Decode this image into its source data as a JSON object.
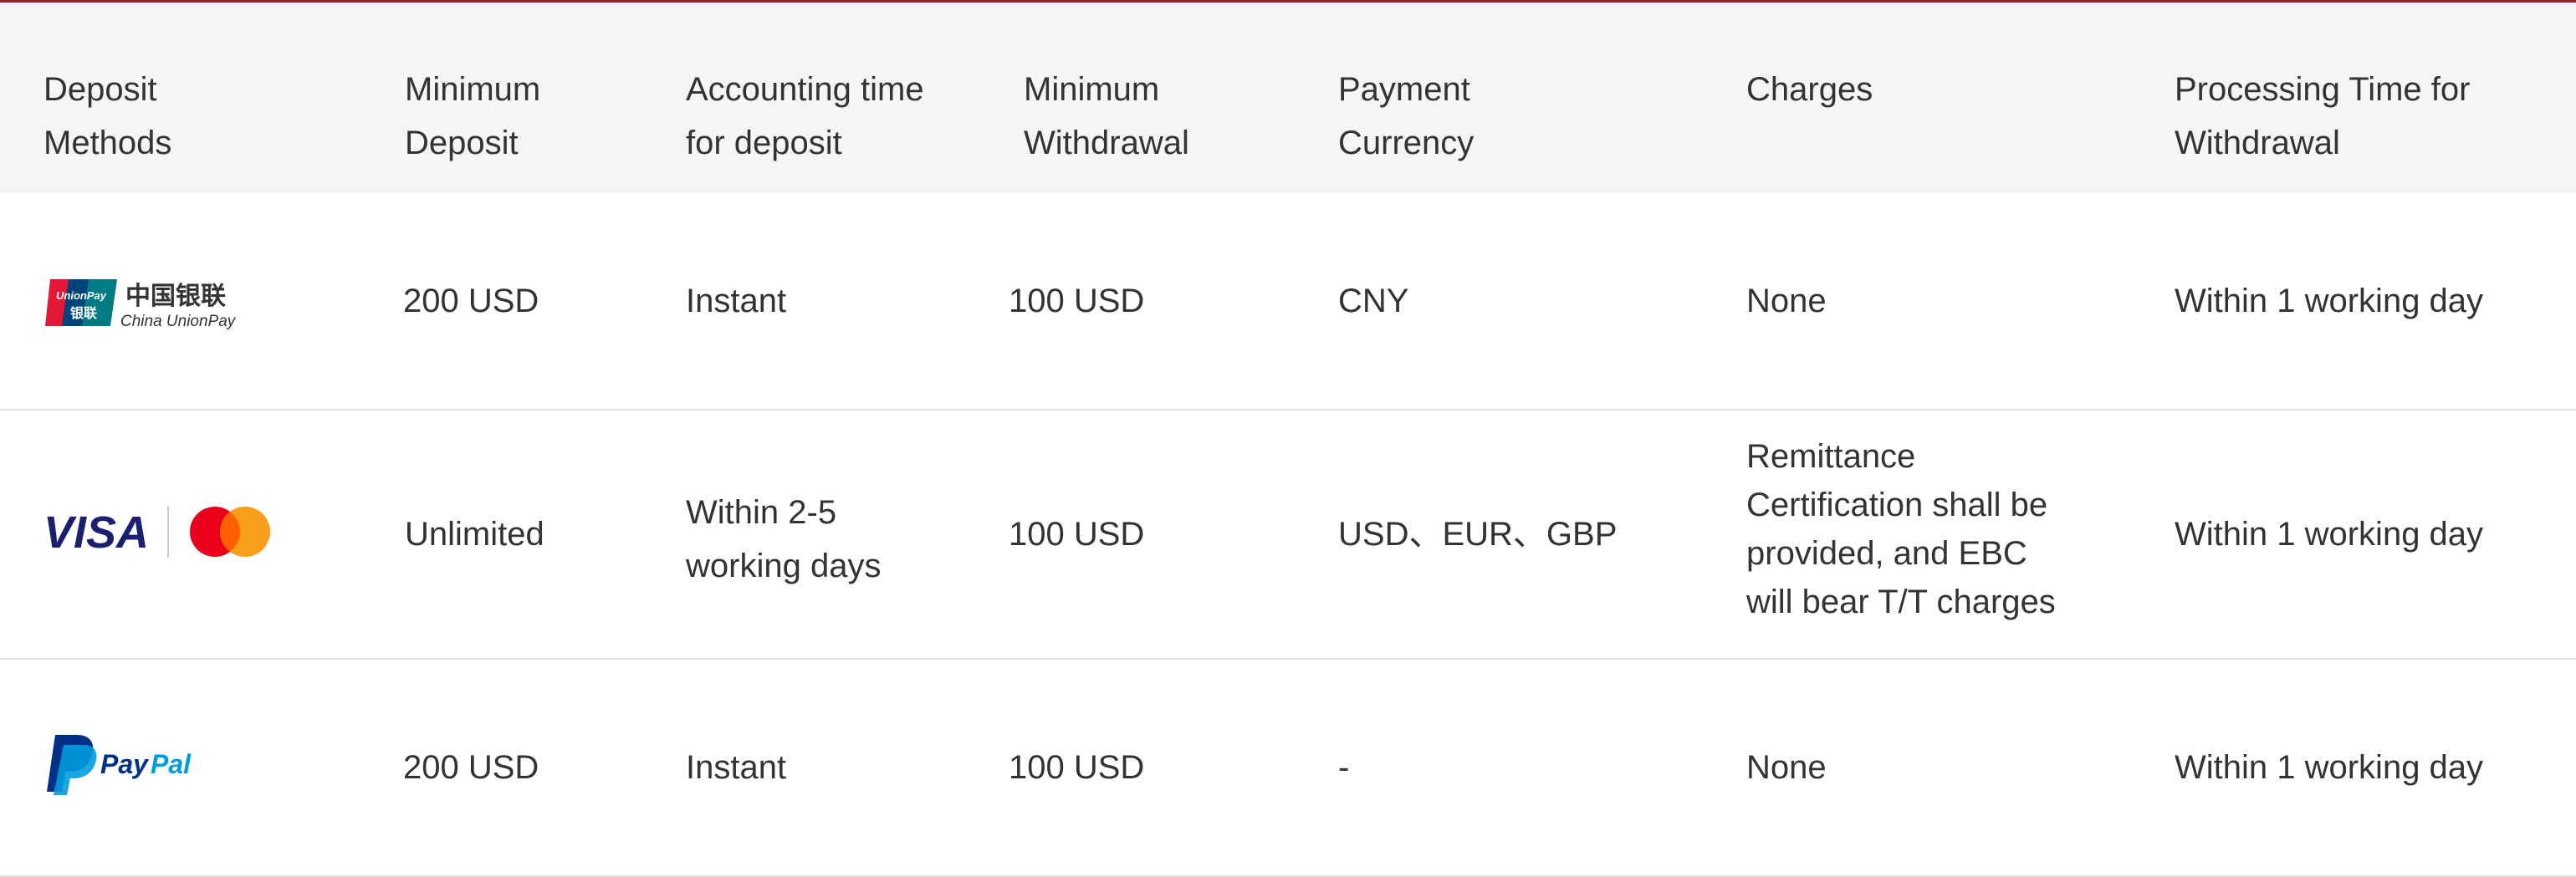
{
  "header": {
    "col1": [
      "Deposit",
      "Methods"
    ],
    "col2": [
      "Minimum",
      "Deposit"
    ],
    "col3": [
      "Accounting time",
      "for deposit"
    ],
    "col4": [
      "Minimum",
      "Withdrawal"
    ],
    "col5": [
      "Payment",
      "Currency"
    ],
    "col6": [
      "Charges",
      ""
    ],
    "col7": [
      "Processing Time for",
      "Withdrawal"
    ]
  },
  "rows": [
    {
      "method_icon": "unionpay-logo",
      "logo_text": {
        "cn": "中国银联",
        "en": "China UnionPay",
        "badge_top": "UnionPay",
        "badge_bottom": "银联"
      },
      "min_deposit": "200 USD",
      "accounting_time": [
        "Instant"
      ],
      "min_withdrawal": "100 USD",
      "currency": "CNY",
      "charges": [
        "None"
      ],
      "processing_time": "Within 1 working day"
    },
    {
      "method_icon": "visa-mastercard-logo",
      "logo_text": {
        "visa": "VISA"
      },
      "min_deposit": "Unlimited",
      "accounting_time": [
        "Within 2-5",
        "working days"
      ],
      "min_withdrawal": "100 USD",
      "currency": "USD、EUR、GBP",
      "charges": [
        "Remittance",
        "Certification shall be",
        "provided, and EBC",
        "will bear T/T charges"
      ],
      "processing_time": "Within 1 working day"
    },
    {
      "method_icon": "paypal-logo",
      "logo_text": {
        "paypal_a": "Pay",
        "paypal_b": "Pal"
      },
      "min_deposit": "200 USD",
      "accounting_time": [
        "Instant"
      ],
      "min_withdrawal": "100 USD",
      "currency": "-",
      "charges": [
        "None"
      ],
      "processing_time": "Within 1 working day"
    }
  ],
  "colors": {
    "accent_rule": "#a01c2a",
    "header_bg": "#f5f5f5",
    "text": "#333333",
    "visa_blue": "#1a1f71",
    "mc_red": "#eb001b",
    "mc_orange": "#f79e1b",
    "paypal_dark": "#003087",
    "paypal_light": "#009cde",
    "unionpay_red": "#e21836",
    "unionpay_blue": "#00447c",
    "unionpay_green": "#007b84"
  }
}
